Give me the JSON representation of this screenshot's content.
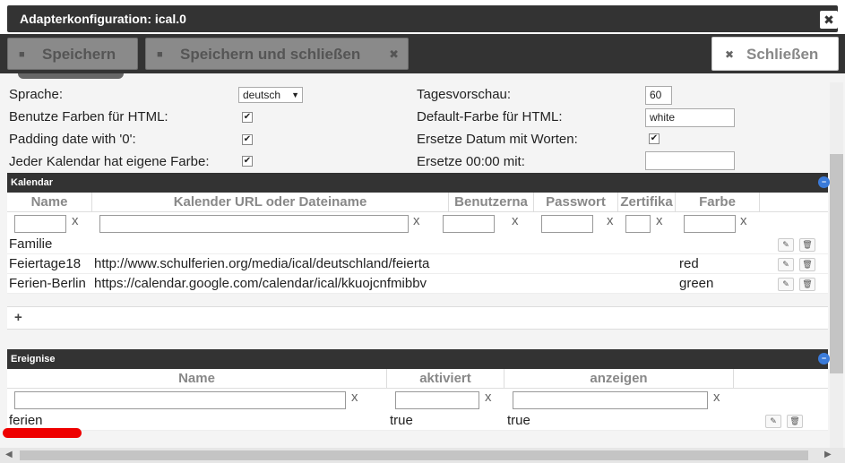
{
  "window": {
    "title": "Adapterkonfiguration: ical.0",
    "close_glyph": "✖"
  },
  "toolbar": {
    "save_label": "Speichern",
    "save_close_label": "Speichern und schließen",
    "close_label": "Schließen",
    "save_icon": "floppy-icon",
    "x_glyph": "✖"
  },
  "settings": {
    "sprache_label": "Sprache:",
    "sprache_value": "deutsch",
    "farben_label": "Benutze Farben für HTML:",
    "padding_label": "Padding date with '0':",
    "eigene_farbe_label": "Jeder Kalendar hat eigene Farbe:",
    "tagesvorschau_label": "Tagesvorschau:",
    "tagesvorschau_value": "60",
    "default_farbe_label": "Default-Farbe für HTML:",
    "default_farbe_value": "white",
    "ersetze_datum_label": "Ersetze Datum mit Worten:",
    "ersetze_zeit_label": "Ersetze 00:00 mit:",
    "ersetze_zeit_value": "",
    "check_glyph": "✔"
  },
  "kalendar": {
    "title": "Kalendar",
    "columns": [
      "Name",
      "Kalender URL oder Dateiname",
      "Benutzerna",
      "Passwort",
      "Zertifika",
      "Farbe"
    ],
    "filter_x": "x",
    "rows": [
      {
        "name": "Familie",
        "url": "",
        "farbe": ""
      },
      {
        "name": "Feiertage18",
        "url": "http://www.schulferien.org/media/ical/deutschland/feierta",
        "farbe": "red"
      },
      {
        "name": "Ferien-Berlin",
        "url": "https://calendar.google.com/calendar/ical/kkuojcnfmibbv",
        "farbe": "green"
      }
    ],
    "add_label": "+"
  },
  "ereignisse": {
    "title": "Ereignise",
    "columns": [
      "Name",
      "aktiviert",
      "anzeigen"
    ],
    "filter_x": "x",
    "rows": [
      {
        "name": "ferien",
        "aktiviert": "true",
        "anzeigen": "true"
      }
    ]
  },
  "colors": {
    "header_dark": "#333333",
    "accent_blue": "#3b7bd9",
    "highlight_red": "#e00000"
  }
}
